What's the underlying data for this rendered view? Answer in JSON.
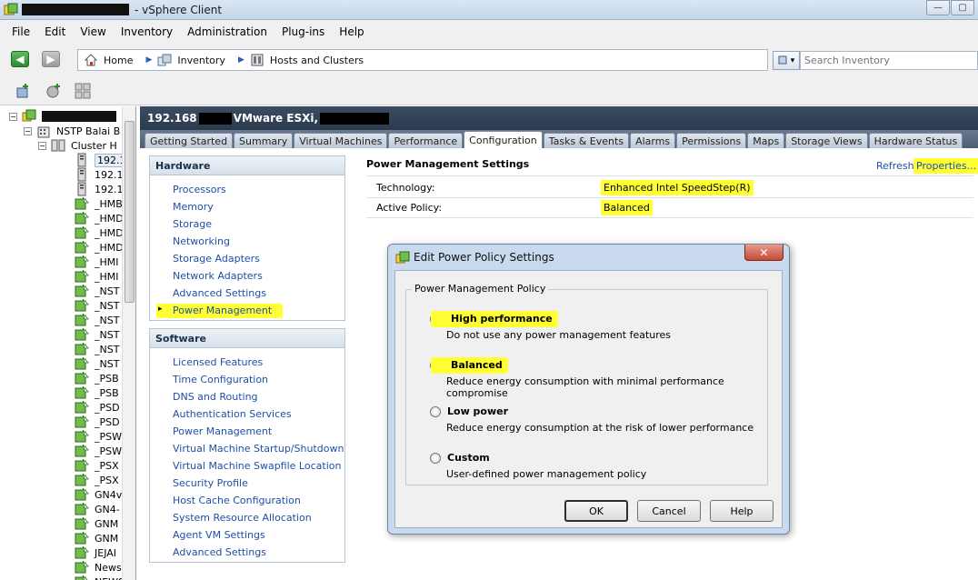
{
  "window": {
    "title": "- vSphere Client"
  },
  "menu": [
    "File",
    "Edit",
    "View",
    "Inventory",
    "Administration",
    "Plug-ins",
    "Help"
  ],
  "breadcrumbs": [
    {
      "label": "Home",
      "icon": "home-icon"
    },
    {
      "label": "Inventory",
      "icon": "inventory-icon"
    },
    {
      "label": "Hosts and Clusters",
      "icon": "hosts-clusters-icon"
    }
  ],
  "search": {
    "placeholder": "Search Inventory"
  },
  "tree": {
    "items": [
      {
        "label": "NSTP Balai B",
        "indent": 1
      },
      {
        "label": "Cluster H",
        "indent": 2
      },
      {
        "label": "192.1",
        "indent": 3,
        "type": "host"
      },
      {
        "label": "192.1",
        "indent": 3,
        "type": "host"
      },
      {
        "label": "192.1",
        "indent": 3,
        "type": "host"
      },
      {
        "label": "_HMB",
        "indent": 3,
        "type": "vm"
      },
      {
        "label": "_HMD",
        "indent": 3,
        "type": "vm"
      },
      {
        "label": "_HMD",
        "indent": 3,
        "type": "vm"
      },
      {
        "label": "_HMD",
        "indent": 3,
        "type": "vm"
      },
      {
        "label": "_HMI",
        "indent": 3,
        "type": "vm"
      },
      {
        "label": "_HMI",
        "indent": 3,
        "type": "vm"
      },
      {
        "label": "_NST",
        "indent": 3,
        "type": "vm"
      },
      {
        "label": "_NST",
        "indent": 3,
        "type": "vm"
      },
      {
        "label": "_NST",
        "indent": 3,
        "type": "vm"
      },
      {
        "label": "_NST",
        "indent": 3,
        "type": "vm"
      },
      {
        "label": "_NST",
        "indent": 3,
        "type": "vm"
      },
      {
        "label": "_NST",
        "indent": 3,
        "type": "vm"
      },
      {
        "label": "_PSB",
        "indent": 3,
        "type": "vm"
      },
      {
        "label": "_PSB",
        "indent": 3,
        "type": "vm"
      },
      {
        "label": "_PSD",
        "indent": 3,
        "type": "vm"
      },
      {
        "label": "_PSD",
        "indent": 3,
        "type": "vm"
      },
      {
        "label": "_PSW",
        "indent": 3,
        "type": "vm"
      },
      {
        "label": "_PSW",
        "indent": 3,
        "type": "vm"
      },
      {
        "label": "_PSX",
        "indent": 3,
        "type": "vm"
      },
      {
        "label": "_PSX",
        "indent": 3,
        "type": "vm"
      },
      {
        "label": "GN4v",
        "indent": 3,
        "type": "vm"
      },
      {
        "label": "GN4-",
        "indent": 3,
        "type": "vm"
      },
      {
        "label": "GNM",
        "indent": 3,
        "type": "vm"
      },
      {
        "label": "GNM",
        "indent": 3,
        "type": "vm"
      },
      {
        "label": "JEJAI",
        "indent": 3,
        "type": "vm"
      },
      {
        "label": "News",
        "indent": 3,
        "type": "vm"
      },
      {
        "label": "NEWS",
        "indent": 3,
        "type": "vm"
      }
    ]
  },
  "host": {
    "prefix": "192.168",
    "middle": "VMware ESXi,",
    "suffix": ""
  },
  "tabs": [
    "Getting Started",
    "Summary",
    "Virtual Machines",
    "Performance",
    "Configuration",
    "Tasks & Events",
    "Alarms",
    "Permissions",
    "Maps",
    "Storage Views",
    "Hardware Status"
  ],
  "active_tab": "Configuration",
  "hardware": {
    "title": "Hardware",
    "items": [
      "Processors",
      "Memory",
      "Storage",
      "Networking",
      "Storage Adapters",
      "Network Adapters",
      "Advanced Settings",
      "Power Management"
    ]
  },
  "software": {
    "title": "Software",
    "items": [
      "Licensed Features",
      "Time Configuration",
      "DNS and Routing",
      "Authentication Services",
      "Power Management",
      "Virtual Machine Startup/Shutdown",
      "Virtual Machine Swapfile Location",
      "Security Profile",
      "Host Cache Configuration",
      "System Resource Allocation",
      "Agent VM Settings",
      "Advanced Settings"
    ]
  },
  "power": {
    "title": "Power Management Settings",
    "refresh": "Refresh",
    "properties": "Properties...",
    "technology_label": "Technology:",
    "technology_value": "Enhanced Intel SpeedStep(R)",
    "policy_label": "Active Policy:",
    "policy_value": "Balanced"
  },
  "dialog": {
    "title": "Edit Power Policy Settings",
    "group": "Power Management Policy",
    "options": [
      {
        "title": "High performance",
        "desc": "Do not use any power management features",
        "selected": false
      },
      {
        "title": "Balanced",
        "desc": "Reduce energy consumption with minimal performance compromise",
        "selected": true
      },
      {
        "title": "Low power",
        "desc": "Reduce energy consumption at the risk of lower performance",
        "selected": false
      },
      {
        "title": "Custom",
        "desc": "User-defined power management policy",
        "selected": false
      }
    ],
    "ok": "OK",
    "cancel": "Cancel",
    "help": "Help"
  },
  "colors": {
    "highlight": "#ffff33",
    "link": "#1f4fa8",
    "header_dark": "#2b3a4d"
  }
}
